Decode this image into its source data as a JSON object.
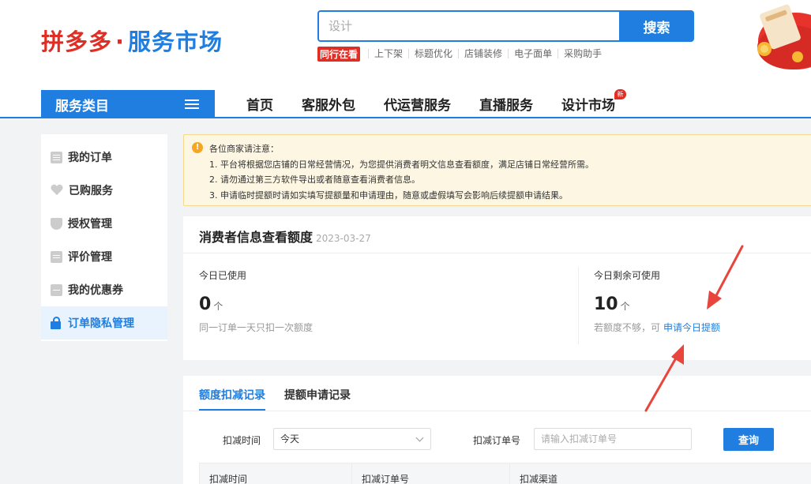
{
  "header": {
    "logo_brand": "拼多多",
    "logo_sep": "·",
    "logo_sub": "服务市场",
    "search_placeholder": "设计",
    "search_button": "搜索",
    "hot_tag": "同行在看",
    "hot_links": [
      "上下架",
      "标题优化",
      "店铺装修",
      "电子面单",
      "采购助手"
    ]
  },
  "category_bar": {
    "label": "服务类目"
  },
  "nav": {
    "items": [
      "首页",
      "客服外包",
      "代运营服务",
      "直播服务",
      "设计市场"
    ],
    "new_badge": "新"
  },
  "sidebar": {
    "items": [
      {
        "label": "我的订单",
        "icon": "document-icon"
      },
      {
        "label": "已购服务",
        "icon": "heart-icon"
      },
      {
        "label": "授权管理",
        "icon": "shield-icon"
      },
      {
        "label": "评价管理",
        "icon": "message-icon"
      },
      {
        "label": "我的优惠券",
        "icon": "coupon-icon"
      },
      {
        "label": "订单隐私管理",
        "icon": "lock-icon",
        "active": true
      }
    ]
  },
  "notice": {
    "title": "各位商家请注意：",
    "lines": [
      "1. 平台将根据您店铺的日常经营情况，为您提供消费者明文信息查看额度，满足店铺日常经营所需。",
      "2. 请勿通过第三方软件导出或者随意查看消费者信息。",
      "3. 申请临时提额时请如实填写提额量和申请理由，随意或虚假填写会影响后续提额申请结果。"
    ]
  },
  "quota": {
    "title": "消费者信息查看额度",
    "date": "2023-03-27",
    "used_label": "今日已使用",
    "used_value": "0",
    "used_unit": "个",
    "used_hint": "同一订单一天只扣一次额度",
    "remain_label": "今日剩余可使用",
    "remain_value": "10",
    "remain_unit": "个",
    "remain_hint": "若额度不够，可",
    "apply_link": "申请今日提额"
  },
  "records": {
    "tabs": [
      "额度扣减记录",
      "提额申请记录"
    ],
    "filter_time_label": "扣减时间",
    "filter_time_value": "今天",
    "filter_order_label": "扣减订单号",
    "filter_order_placeholder": "请输入扣减订单号",
    "query_button": "查询",
    "columns": [
      "扣减时间",
      "扣减订单号",
      "扣减渠道"
    ]
  },
  "colors": {
    "brand_red": "#e02e24",
    "primary_blue": "#1f7ee0",
    "notice_bg": "#fdf6e3",
    "arrow_red": "#e8453c"
  }
}
